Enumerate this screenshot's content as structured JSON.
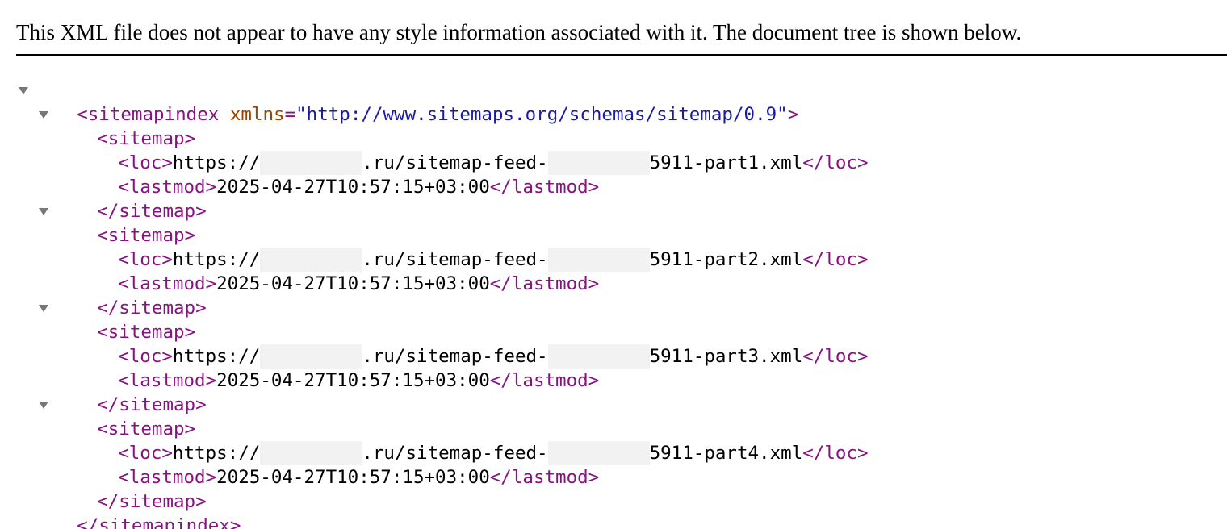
{
  "header": {
    "notice": "This XML file does not appear to have any style information associated with it. The document tree is shown below."
  },
  "tree": {
    "root_open_tag": "<sitemapindex",
    "root_attr_name": "xmlns",
    "root_attr_eq": "=",
    "root_attr_value": "\"http://www.sitemaps.org/schemas/sitemap/0.9\"",
    "root_open_close": ">",
    "root_close": "</sitemapindex>",
    "sitemap_open": "<sitemap>",
    "sitemap_close": "</sitemap>",
    "loc_open": "<loc>",
    "loc_close": "</loc>",
    "lastmod_open": "<lastmod>",
    "lastmod_close": "</lastmod>",
    "loc_prefix": "https://",
    "loc_domain_suffix": ".ru/sitemap-feed-",
    "sitemaps": [
      {
        "loc_file": "5911-part1.xml",
        "lastmod": "2025-04-27T10:57:15+03:00"
      },
      {
        "loc_file": "5911-part2.xml",
        "lastmod": "2025-04-27T10:57:15+03:00"
      },
      {
        "loc_file": "5911-part3.xml",
        "lastmod": "2025-04-27T10:57:15+03:00"
      },
      {
        "loc_file": "5911-part4.xml",
        "lastmod": "2025-04-27T10:57:15+03:00"
      }
    ]
  }
}
